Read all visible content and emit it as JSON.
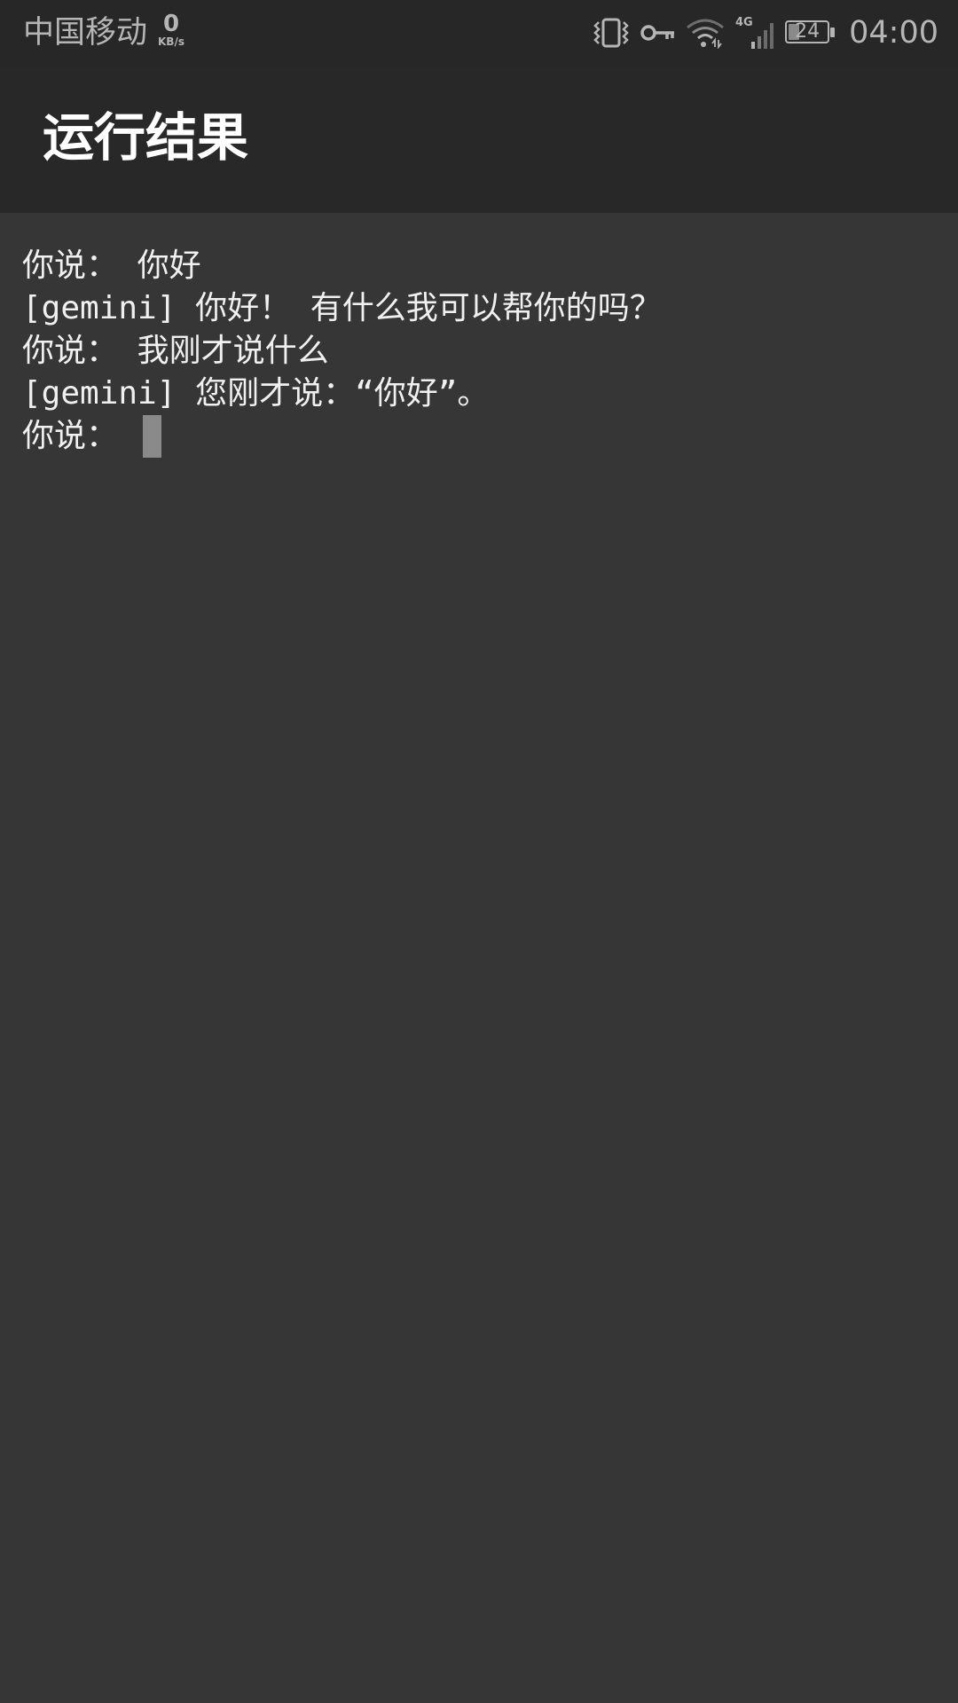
{
  "status_bar": {
    "carrier": "中国移动",
    "net_speed_value": "0",
    "net_speed_unit": "KB/s",
    "network_type": "4G",
    "battery_level": "24",
    "time": "04:00",
    "icons": [
      "vibrate-icon",
      "vpn-key-icon",
      "wifi-icon",
      "cellular-signal-icon",
      "battery-icon"
    ]
  },
  "app_bar": {
    "title": "运行结果"
  },
  "console": {
    "lines": [
      "你说： 你好",
      "[gemini] 你好！ 有什么我可以帮你的吗？",
      "你说： 我刚才说什么",
      "[gemini] 您刚才说：“你好”。"
    ],
    "prompt": "你说： "
  },
  "colors": {
    "status_bar_bg": "#272727",
    "app_bar_bg": "#282828",
    "console_bg": "#363636",
    "text": "#f0f0f0",
    "cursor": "#8a8a8a"
  }
}
